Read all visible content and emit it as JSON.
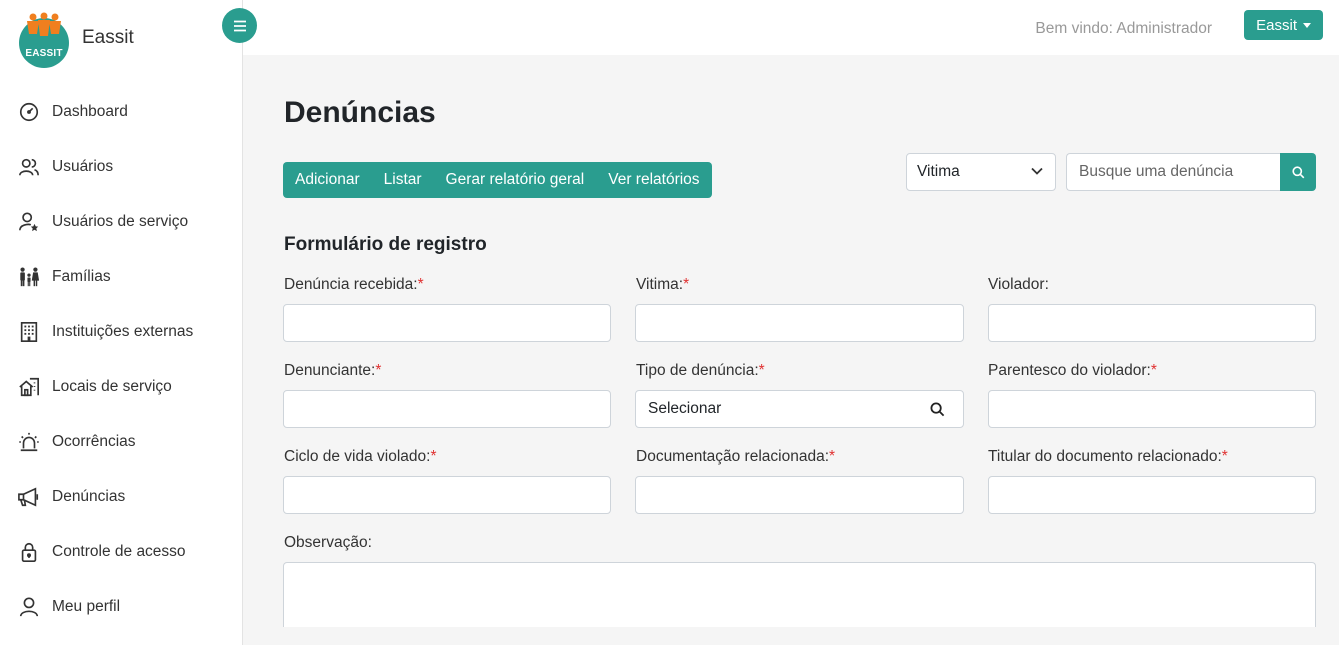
{
  "brand": {
    "logo_text": "EASSIT",
    "name": "Eassit"
  },
  "sidebar": {
    "items": [
      {
        "label": "Dashboard",
        "icon": "dashboard-gauge-icon"
      },
      {
        "label": "Usuários",
        "icon": "users-icon"
      },
      {
        "label": "Usuários de serviço",
        "icon": "user-star-icon"
      },
      {
        "label": "Famílias",
        "icon": "family-icon"
      },
      {
        "label": "Instituições externas",
        "icon": "building-icon"
      },
      {
        "label": "Locais de serviço",
        "icon": "house-city-icon"
      },
      {
        "label": "Ocorrências",
        "icon": "alarm-siren-icon"
      },
      {
        "label": "Denúncias",
        "icon": "megaphone-icon"
      },
      {
        "label": "Controle de acesso",
        "icon": "lock-icon"
      },
      {
        "label": "Meu perfil",
        "icon": "user-icon"
      }
    ]
  },
  "topbar": {
    "welcome": "Bem vindo: Administrador",
    "user_menu_label": "Eassit"
  },
  "main": {
    "title": "Denúncias",
    "actions": [
      "Adicionar",
      "Listar",
      "Gerar relatório geral",
      "Ver relatórios"
    ],
    "filter": {
      "selected": "Vitima"
    },
    "search": {
      "placeholder": "Busque uma denúncia"
    }
  },
  "form": {
    "title": "Formulário de registro",
    "fields": [
      {
        "label": "Denúncia recebida:",
        "required": "*",
        "value": ""
      },
      {
        "label": "Vitima:",
        "required": "*",
        "value": ""
      },
      {
        "label": "Violador:",
        "required": "",
        "value": ""
      },
      {
        "label": "Denunciante:",
        "required": "*",
        "value": ""
      },
      {
        "label": "Tipo de denúncia:",
        "required": "*",
        "value": "Selecionar"
      },
      {
        "label": "Parentesco do violador:",
        "required": "*",
        "value": ""
      },
      {
        "label": "Ciclo de vida violado:",
        "required": "*",
        "value": ""
      },
      {
        "label": "Documentação relacionada:",
        "required": "*",
        "value": ""
      },
      {
        "label": "Titular do documento relacionado:",
        "required": "*",
        "value": ""
      }
    ],
    "observation_label": "Observação:"
  },
  "colors": {
    "accent": "#2a9d8f",
    "required": "#e03131"
  }
}
